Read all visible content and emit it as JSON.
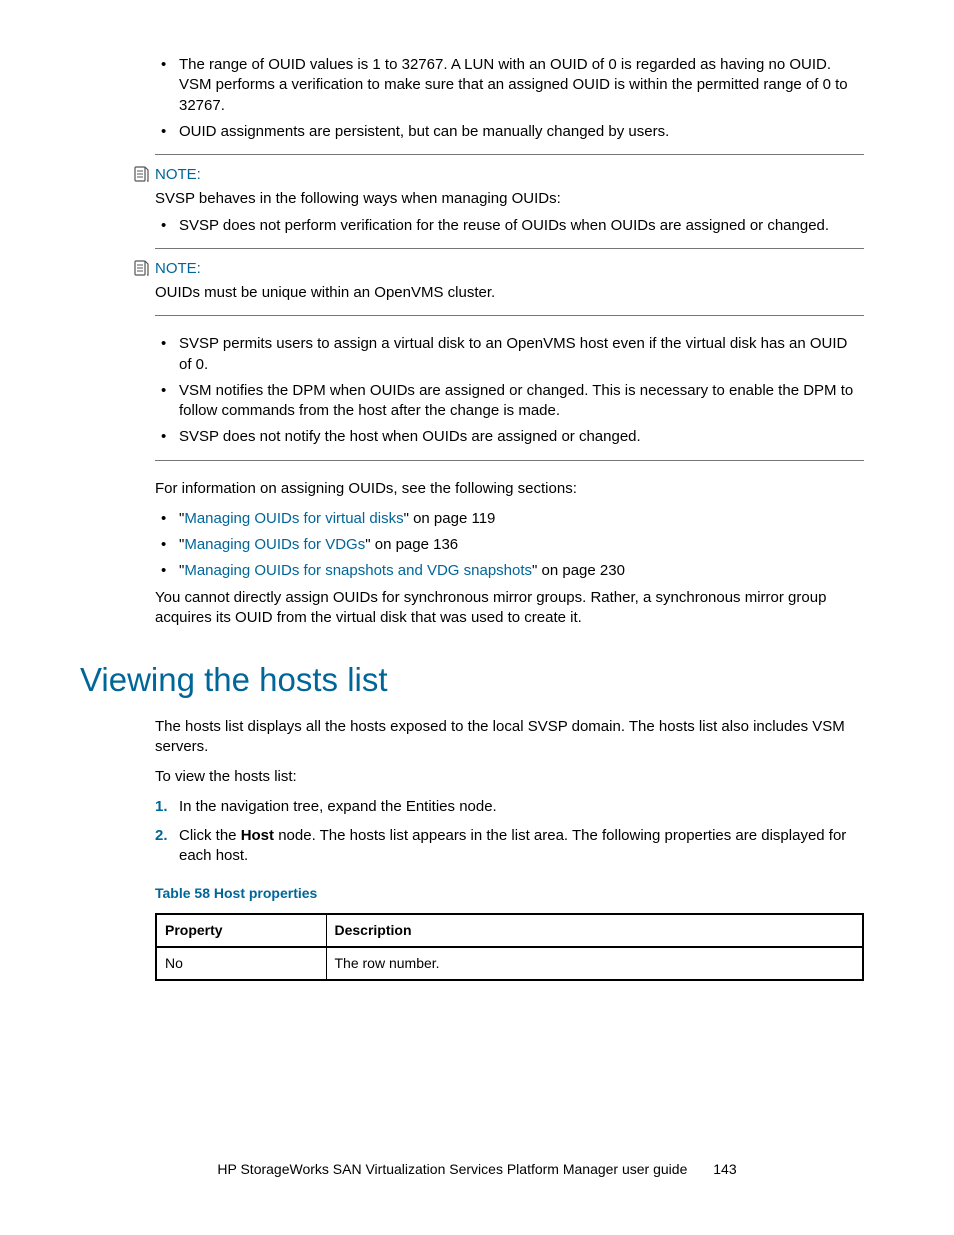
{
  "top_bullets": [
    "The range of OUID values is 1 to 32767. A LUN with an OUID of 0 is regarded as having no OUID. VSM performs a verification to make sure that an assigned OUID is within the permitted range of 0 to 32767.",
    "OUID assignments are persistent, but can be manually changed by users."
  ],
  "note1": {
    "label": "NOTE:",
    "intro": "SVSP behaves in the following ways when managing OUIDs:",
    "bullets": [
      "SVSP does not perform verification for the reuse of OUIDs when OUIDs are assigned or changed."
    ]
  },
  "note2": {
    "label": "NOTE:",
    "body": "OUIDs must be unique within an OpenVMS cluster."
  },
  "after_notes_bullets": [
    "SVSP permits users to assign a virtual disk to an OpenVMS host even if the virtual disk has an OUID of 0.",
    "VSM notifies the DPM when OUIDs are assigned or changed. This is necessary to enable the DPM to follow commands from the host after the change is made.",
    "SVSP does not notify the host when OUIDs are assigned or changed."
  ],
  "crossref_intro": "For information on assigning OUIDs, see the following sections:",
  "crossrefs": [
    {
      "link": "Managing OUIDs for virtual disks",
      "suffix": "\" on page 119"
    },
    {
      "link": "Managing OUIDs for VDGs",
      "suffix": "\" on page 136"
    },
    {
      "link": "Managing OUIDs for snapshots and VDG snapshots",
      "suffix": "\" on page 230"
    }
  ],
  "crossref_prefix": "\"",
  "mirror_para": "You cannot directly assign OUIDs for synchronous mirror groups. Rather, a synchronous mirror group acquires its OUID from the virtual disk that was used to create it.",
  "section": {
    "title": "Viewing the hosts list",
    "p1": "The hosts list displays all the hosts exposed to the local SVSP domain. The hosts list also includes VSM servers.",
    "p2": "To view the hosts list:",
    "steps": {
      "s1": "In the navigation tree, expand the Entities node.",
      "s2_pre": "Click the ",
      "s2_bold": "Host",
      "s2_post": " node. The hosts list appears in the list area. The following properties are displayed for each host."
    },
    "table_caption": "Table 58 Host properties",
    "table": {
      "h1": "Property",
      "h2": "Description",
      "r1c1": "No",
      "r1c2": "The row number."
    }
  },
  "footer": {
    "title": "HP StorageWorks SAN Virtualization Services Platform Manager user guide",
    "page": "143"
  }
}
